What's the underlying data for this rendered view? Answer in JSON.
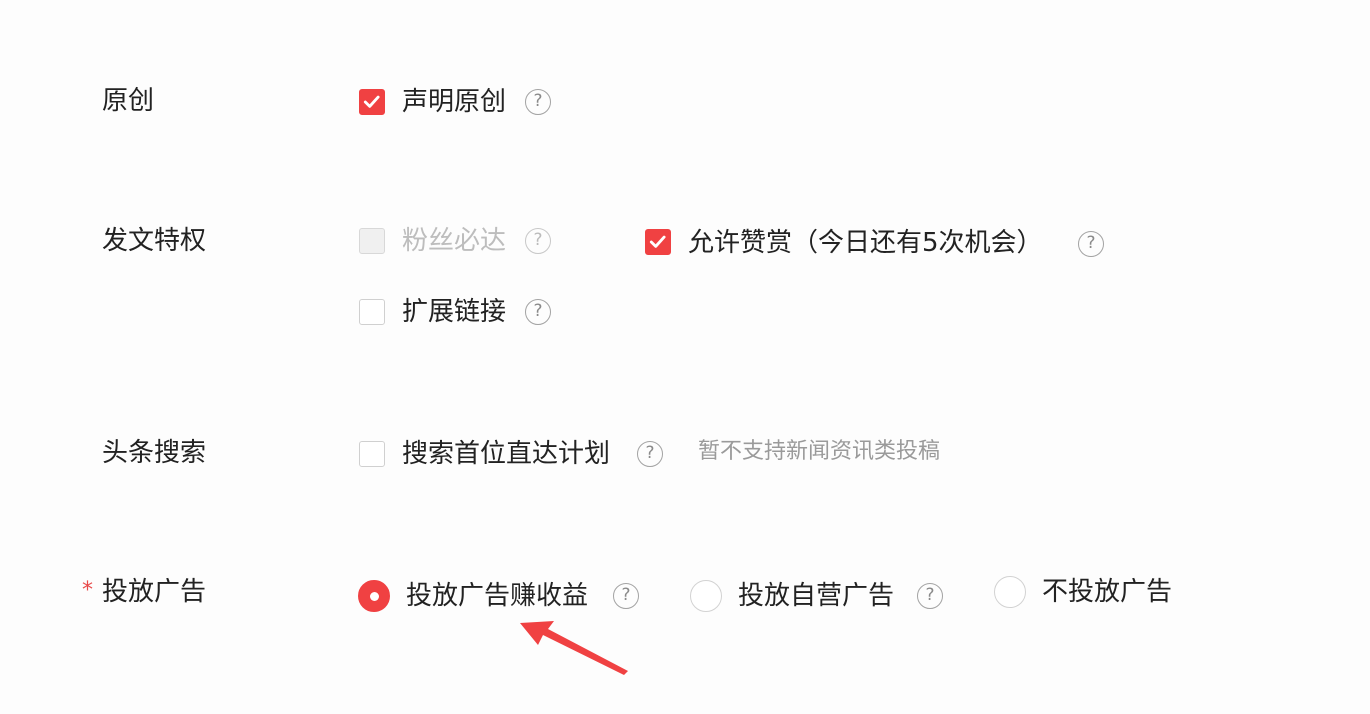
{
  "rows": {
    "original": {
      "label": "原创",
      "declare_original": {
        "label": "声明原创",
        "checked": true,
        "help_icon": "question-circle-icon"
      }
    },
    "privileges": {
      "label": "发文特权",
      "fans_reach": {
        "label": "粉丝必达",
        "checked": false,
        "disabled": true,
        "help_icon": "question-circle-icon"
      },
      "allow_reward": {
        "label": "允许赞赏（今日还有5次机会）",
        "checked": true,
        "help_icon": "question-circle-icon"
      },
      "extended_link": {
        "label": "扩展链接",
        "checked": false,
        "help_icon": "question-circle-icon"
      }
    },
    "search": {
      "label": "头条搜索",
      "direct_plan": {
        "label": "搜索首位直达计划",
        "checked": false,
        "help_icon": "question-circle-icon"
      },
      "hint": "暂不支持新闻资讯类投稿"
    },
    "ads": {
      "label": "投放广告",
      "required_mark": "*",
      "options": [
        {
          "label": "投放广告赚收益",
          "selected": true,
          "help_icon": "question-circle-icon"
        },
        {
          "label": "投放自营广告",
          "selected": false,
          "help_icon": "question-circle-icon"
        },
        {
          "label": "不投放广告",
          "selected": false
        }
      ]
    }
  },
  "help_glyph": "?",
  "annotation": {
    "icon": "red-arrow-icon",
    "color": "#f04142"
  },
  "colors": {
    "accent": "#f04142",
    "text": "#222222",
    "muted": "#9a9a9a",
    "border": "#d0d0d0"
  }
}
